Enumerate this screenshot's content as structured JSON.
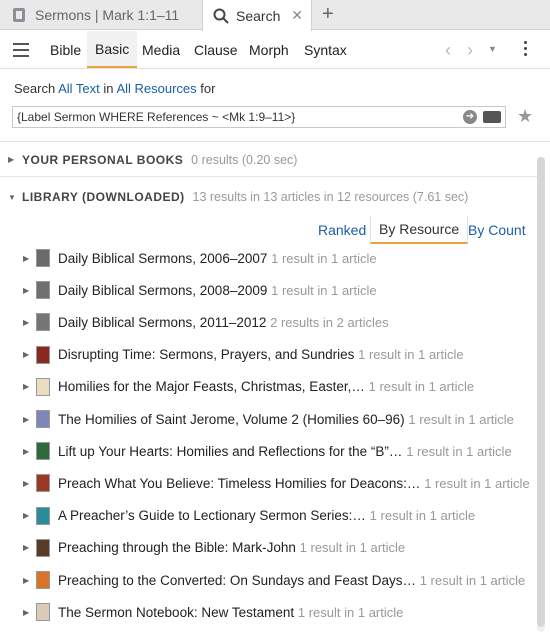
{
  "tabs": [
    {
      "label": "Sermons | Mark 1:1–11",
      "icon": "document-icon",
      "active": false
    },
    {
      "label": "Search",
      "icon": "search-icon",
      "active": true
    }
  ],
  "toolbar": {
    "items": [
      {
        "label": "Bible",
        "active": false
      },
      {
        "label": "Basic",
        "active": true
      },
      {
        "label": "Media",
        "active": false
      },
      {
        "label": "Clause",
        "active": false
      },
      {
        "label": "Morph",
        "active": false
      },
      {
        "label": "Syntax",
        "active": false
      }
    ]
  },
  "search": {
    "prefix": "Search",
    "scope_text": "All Text",
    "middle": "in",
    "scope_resources": "All Resources",
    "suffix": "for",
    "query": "{Label Sermon WHERE References ~ <Mk 1:9–11>}"
  },
  "sections": {
    "personal": {
      "title": "YOUR PERSONAL BOOKS",
      "info": "0 results (0.20 sec)"
    },
    "library": {
      "title": "LIBRARY (DOWNLOADED)",
      "info": "13 results in 13 articles in 12 resources (7.61 sec)"
    }
  },
  "view_tabs": {
    "ranked": "Ranked",
    "by_resource": "By Resource",
    "by_count": "By Count"
  },
  "results": [
    {
      "title": "Daily Biblical Sermons, 2006–2007",
      "count": "1 result in 1 article",
      "cover_color": "#6b6b6b"
    },
    {
      "title": "Daily Biblical Sermons, 2008–2009",
      "count": "1 result in 1 article",
      "cover_color": "#707070"
    },
    {
      "title": "Daily Biblical Sermons, 2011–2012",
      "count": "2 results in 2 articles",
      "cover_color": "#757575"
    },
    {
      "title": "Disrupting Time: Sermons, Prayers, and Sundries",
      "count": "1 result in 1 article",
      "cover_color": "#8a2a1e"
    },
    {
      "title": "Homilies for the Major Feasts, Christmas, Easter,…",
      "count": "1 result in 1 article",
      "cover_color": "#e9dcc0"
    },
    {
      "title": "The Homilies of Saint Jerome, Volume 2 (Homilies 60–96)",
      "count": "1 result in 1 article",
      "cover_color": "#7f86b8"
    },
    {
      "title": "Lift up Your Hearts: Homilies and Reflections for the “B”…",
      "count": "1 result in 1 article",
      "cover_color": "#2f6b3a"
    },
    {
      "title": "Preach What You Believe: Timeless Homilies for Deacons:…",
      "count": "1 result in 1 article",
      "cover_color": "#9b3a22"
    },
    {
      "title": "A Preacher’s Guide to Lectionary Sermon Series:…",
      "count": "1 result in 1 article",
      "cover_color": "#2a8c9a"
    },
    {
      "title": "Preaching through the Bible: Mark-John",
      "count": "1 result in 1 article",
      "cover_color": "#5a3a28"
    },
    {
      "title": "Preaching to the Converted: On Sundays and Feast Days…",
      "count": "1 result in 1 article",
      "cover_color": "#d8742a"
    },
    {
      "title": "The Sermon Notebook: New Testament",
      "count": "1 result in 1 article",
      "cover_color": "#d9cbb7"
    }
  ]
}
